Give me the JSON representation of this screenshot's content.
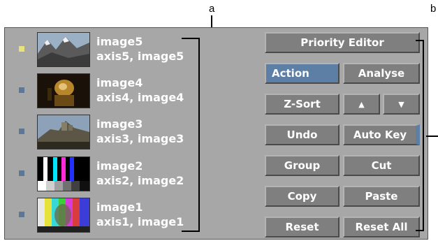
{
  "callouts": {
    "a": "a",
    "b": "b"
  },
  "layers": [
    {
      "name": "image5",
      "sub": "axis5, image5",
      "selected": true
    },
    {
      "name": "image4",
      "sub": "axis4, image4",
      "selected": false
    },
    {
      "name": "image3",
      "sub": "axis3, image3",
      "selected": false
    },
    {
      "name": "image2",
      "sub": "axis2, image2",
      "selected": false
    },
    {
      "name": "image1",
      "sub": "axis1, image1",
      "selected": false
    }
  ],
  "buttons": {
    "priority_editor": "Priority Editor",
    "action": "Action",
    "analyse": "Analyse",
    "z_sort": "Z-Sort",
    "up": "▲",
    "down": "▼",
    "undo": "Undo",
    "auto_key": "Auto Key",
    "group": "Group",
    "cut": "Cut",
    "copy": "Copy",
    "paste": "Paste",
    "reset": "Reset",
    "reset_all": "Reset All"
  },
  "colors": {
    "panel": "#a7a7a7",
    "button": "#7f7f7f",
    "active_button": "#5d7fa6",
    "selected_dot": "#e7e37a",
    "dot": "#5c7896"
  }
}
